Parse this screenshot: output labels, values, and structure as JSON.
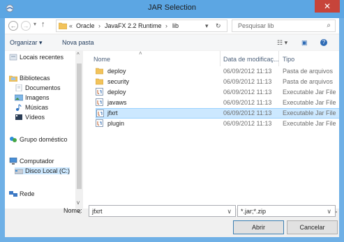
{
  "window": {
    "title": "JAR Selection",
    "close_glyph": "✕",
    "titlebar_color": "#5ca6e3",
    "close_color": "#c7443a"
  },
  "nav": {
    "back_glyph": "←",
    "forward_glyph": "→",
    "recent_glyph": "▾",
    "up_glyph": "↑",
    "breadcrumb_prefix": "«",
    "breadcrumb": [
      "Oracle",
      "JavaFX 2.2 Runtime",
      "lib"
    ],
    "breadcrumb_sep": "›",
    "dropdown_glyph": "▾",
    "refresh_glyph": "↻",
    "search_placeholder": "Pesquisar lib",
    "search_glyph": "⌕"
  },
  "toolbar": {
    "organize": "Organizar ▾",
    "new_folder": "Nova pasta",
    "view_glyph": "☷ ▾",
    "preview_glyph": "▣",
    "help_glyph": "?"
  },
  "nav_pane": {
    "items": [
      {
        "label": "Locais recentes",
        "icon": "recent-places-icon"
      },
      {
        "label": "Bibliotecas",
        "icon": "libraries-icon"
      },
      {
        "label": "Documentos",
        "icon": "documents-icon"
      },
      {
        "label": "Imagens",
        "icon": "pictures-icon"
      },
      {
        "label": "Músicas",
        "icon": "music-icon"
      },
      {
        "label": "Vídeos",
        "icon": "videos-icon"
      },
      {
        "label": "Grupo doméstico",
        "icon": "homegroup-icon"
      },
      {
        "label": "Computador",
        "icon": "computer-icon"
      },
      {
        "label": "Disco Local (C:)",
        "icon": "drive-icon"
      },
      {
        "label": "Rede",
        "icon": "network-icon"
      }
    ]
  },
  "columns": {
    "name": "Nome",
    "date": "Data de modificaç...",
    "type": "Tipo",
    "sort_glyph": "˄"
  },
  "files": [
    {
      "name": "deploy",
      "date": "06/09/2012 11:13",
      "type": "Pasta de arquivos",
      "kind": "folder"
    },
    {
      "name": "security",
      "date": "06/09/2012 11:13",
      "type": "Pasta de arquivos",
      "kind": "folder"
    },
    {
      "name": "deploy",
      "date": "06/09/2012 11:13",
      "type": "Executable Jar File",
      "kind": "jar"
    },
    {
      "name": "javaws",
      "date": "06/09/2012 11:13",
      "type": "Executable Jar File",
      "kind": "jar"
    },
    {
      "name": "jfxrt",
      "date": "06/09/2012 11:13",
      "type": "Executable Jar File",
      "kind": "jar"
    },
    {
      "name": "plugin",
      "date": "06/09/2012 11:13",
      "type": "Executable Jar File",
      "kind": "jar"
    }
  ],
  "footer": {
    "filename_label": "Nome:",
    "filename_value": "jfxrt",
    "filter_value": "*.jar;*.zip",
    "open_label": "Abrir",
    "cancel_label": "Cancelar",
    "combo_glyph": "∨",
    "scroll_left_glyph": "<",
    "scroll_right_glyph": ">",
    "scroll_up_glyph": "^",
    "scroll_down_glyph": "v"
  }
}
